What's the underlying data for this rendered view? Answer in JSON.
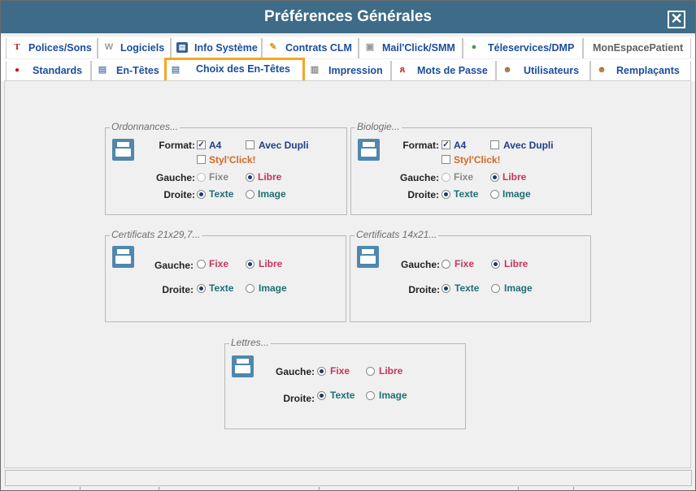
{
  "window": {
    "title": "Préférences Générales",
    "close_symbol": "✕"
  },
  "tabs_row1": [
    {
      "label": "Polices/Sons",
      "icon": "font-icon"
    },
    {
      "label": "Logiciels",
      "icon": "software-icon"
    },
    {
      "label": "Info Système",
      "icon": "system-info-icon"
    },
    {
      "label": "Contrats CLM",
      "icon": "pencil-icon"
    },
    {
      "label": "Mail'Click/SMM",
      "icon": "mail-icon"
    },
    {
      "label": "Téleservices/DMP",
      "icon": "globe-icon"
    },
    {
      "label": "MonEspacePatient",
      "icon": ""
    }
  ],
  "tabs_row2": [
    {
      "label": "Standards",
      "icon": "red-dot-icon"
    },
    {
      "label": "En-Têtes",
      "icon": "document-icon"
    },
    {
      "label": "Choix des En-Têtes",
      "icon": "document-icon"
    },
    {
      "label": "Impression",
      "icon": "printer-icon"
    },
    {
      "label": "Mots de Passe",
      "icon": "password-icon"
    },
    {
      "label": "Utilisateurs",
      "icon": "user-icon"
    },
    {
      "label": "Remplaçants",
      "icon": "users-icon"
    }
  ],
  "active_tab": "Choix des En-Têtes",
  "groups": {
    "ordonnances": {
      "caption": "Ordonnances...",
      "format_label": "Format:",
      "a4_label": "A4",
      "a4_checked": true,
      "avec_dupli_label": "Avec Dupli",
      "avec_dupli_checked": false,
      "stylclick_label": "Styl'Click!",
      "stylclick_checked": false,
      "gauche_label": "Gauche:",
      "fixe_label": "Fixe",
      "libre_label": "Libre",
      "gauche_selected": "Libre",
      "droite_label": "Droite:",
      "texte_label": "Texte",
      "image_label": "Image",
      "droite_selected": "Texte"
    },
    "biologie": {
      "caption": "Biologie...",
      "format_label": "Format:",
      "a4_label": "A4",
      "a4_checked": true,
      "avec_dupli_label": "Avec Dupli",
      "avec_dupli_checked": false,
      "stylclick_label": "Styl'Click!",
      "stylclick_checked": false,
      "gauche_label": "Gauche:",
      "fixe_label": "Fixe",
      "libre_label": "Libre",
      "gauche_selected": "Libre",
      "droite_label": "Droite:",
      "texte_label": "Texte",
      "image_label": "Image",
      "droite_selected": "Texte"
    },
    "cert_21": {
      "caption": "Certificats 21x29,7...",
      "gauche_label": "Gauche:",
      "fixe_label": "Fixe",
      "libre_label": "Libre",
      "gauche_selected": "Libre",
      "droite_label": "Droite:",
      "texte_label": "Texte",
      "image_label": "Image",
      "droite_selected": "Texte"
    },
    "cert_14": {
      "caption": "Certificats 14x21...",
      "gauche_label": "Gauche:",
      "fixe_label": "Fixe",
      "libre_label": "Libre",
      "gauche_selected": "Libre",
      "droite_label": "Droite:",
      "texte_label": "Texte",
      "image_label": "Image",
      "droite_selected": "Texte"
    },
    "lettres": {
      "caption": "Lettres...",
      "gauche_label": "Gauche:",
      "fixe_label": "Fixe",
      "libre_label": "Libre",
      "gauche_selected": "Fixe",
      "droite_label": "Droite:",
      "texte_label": "Texte",
      "image_label": "Image",
      "droite_selected": "Texte"
    }
  },
  "colors": {
    "titlebar": "#3e6b87",
    "tab_text": "#1a4d9a",
    "highlight": "#f5a623",
    "printer": "#4f87ad",
    "teal": "#1f6f74",
    "pink": "#c8345e",
    "orange": "#d06a28"
  }
}
